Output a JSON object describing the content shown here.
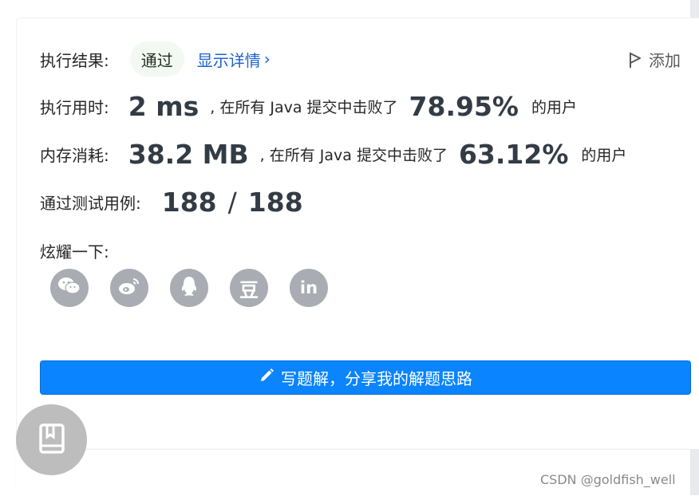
{
  "result": {
    "label": "执行结果:",
    "status": "通过",
    "details_link": "显示详情",
    "details_chevron": "›",
    "add_note": "添加"
  },
  "runtime": {
    "label": "执行用时:",
    "value": "2 ms",
    "middle": ", 在所有 Java 提交中击败了",
    "percent": "78.95%",
    "suffix": "的用户"
  },
  "memory": {
    "label": "内存消耗:",
    "value": "38.2 MB",
    "middle": ", 在所有 Java 提交中击败了",
    "percent": "63.12%",
    "suffix": "的用户"
  },
  "testcases": {
    "label": "通过测试用例:",
    "passed": "188",
    "separator": "/",
    "total": "188"
  },
  "share": {
    "label": "炫耀一下:",
    "buttons": [
      {
        "icon": "wechat-icon"
      },
      {
        "icon": "weibo-icon"
      },
      {
        "icon": "qq-icon"
      },
      {
        "icon": "douban-icon",
        "text": "豆"
      },
      {
        "icon": "linkedin-icon",
        "text": "in"
      }
    ]
  },
  "write_solution": {
    "label": "写题解，分享我的解题思路"
  },
  "watermark": "CSDN @goldfish_well",
  "colors": {
    "accent_blue": "#0a84ff",
    "link_blue": "#1e62d0",
    "share_gray": "#a9acb2",
    "pass_badge_bg": "#f2f8f2"
  }
}
